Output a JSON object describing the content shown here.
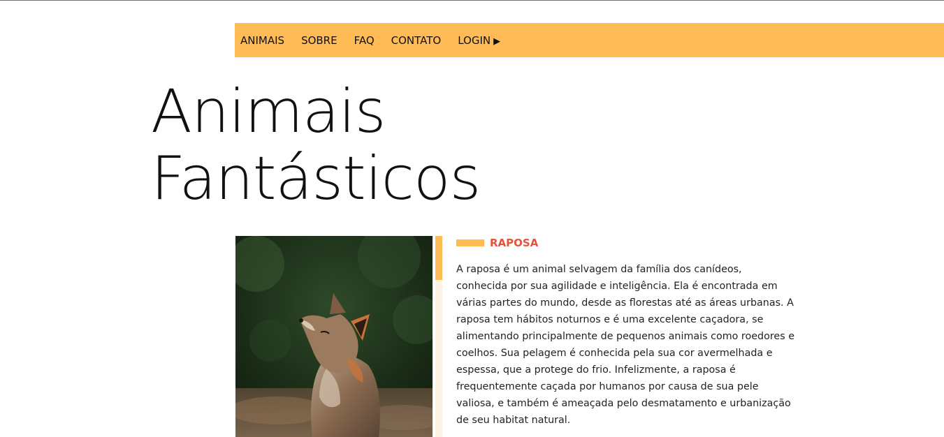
{
  "nav": {
    "items": [
      {
        "label": "ANIMAIS"
      },
      {
        "label": "SOBRE"
      },
      {
        "label": "FAQ"
      },
      {
        "label": "CONTATO"
      },
      {
        "label": "LOGIN",
        "icon": "triangle-right-icon"
      }
    ]
  },
  "hero": {
    "title_line1": "Animais",
    "title_line2": "Fantásticos"
  },
  "animal": {
    "name": "RAPOSA",
    "image_subject": "fox",
    "description": "A raposa é um animal selvagem da família dos canídeos, conhecida por sua agilidade e inteligência. Ela é encontrada em várias partes do mundo, desde as florestas até as áreas urbanas. A raposa tem hábitos noturnos e é uma excelente caçadora, se alimentando principalmente de pequenos animais como roedores e coelhos. Sua pelagem é conhecida pela sua cor avermelhada e espessa, que a protege do frio. Infelizmente, a raposa é frequentemente caçada por humanos por causa de sua pele valiosa, e também é ameaçada pelo desmatamento e urbanização de seu habitat natural."
  },
  "colors": {
    "accent": "#ffbb55",
    "heading": "#e5533d",
    "text": "#111111"
  }
}
